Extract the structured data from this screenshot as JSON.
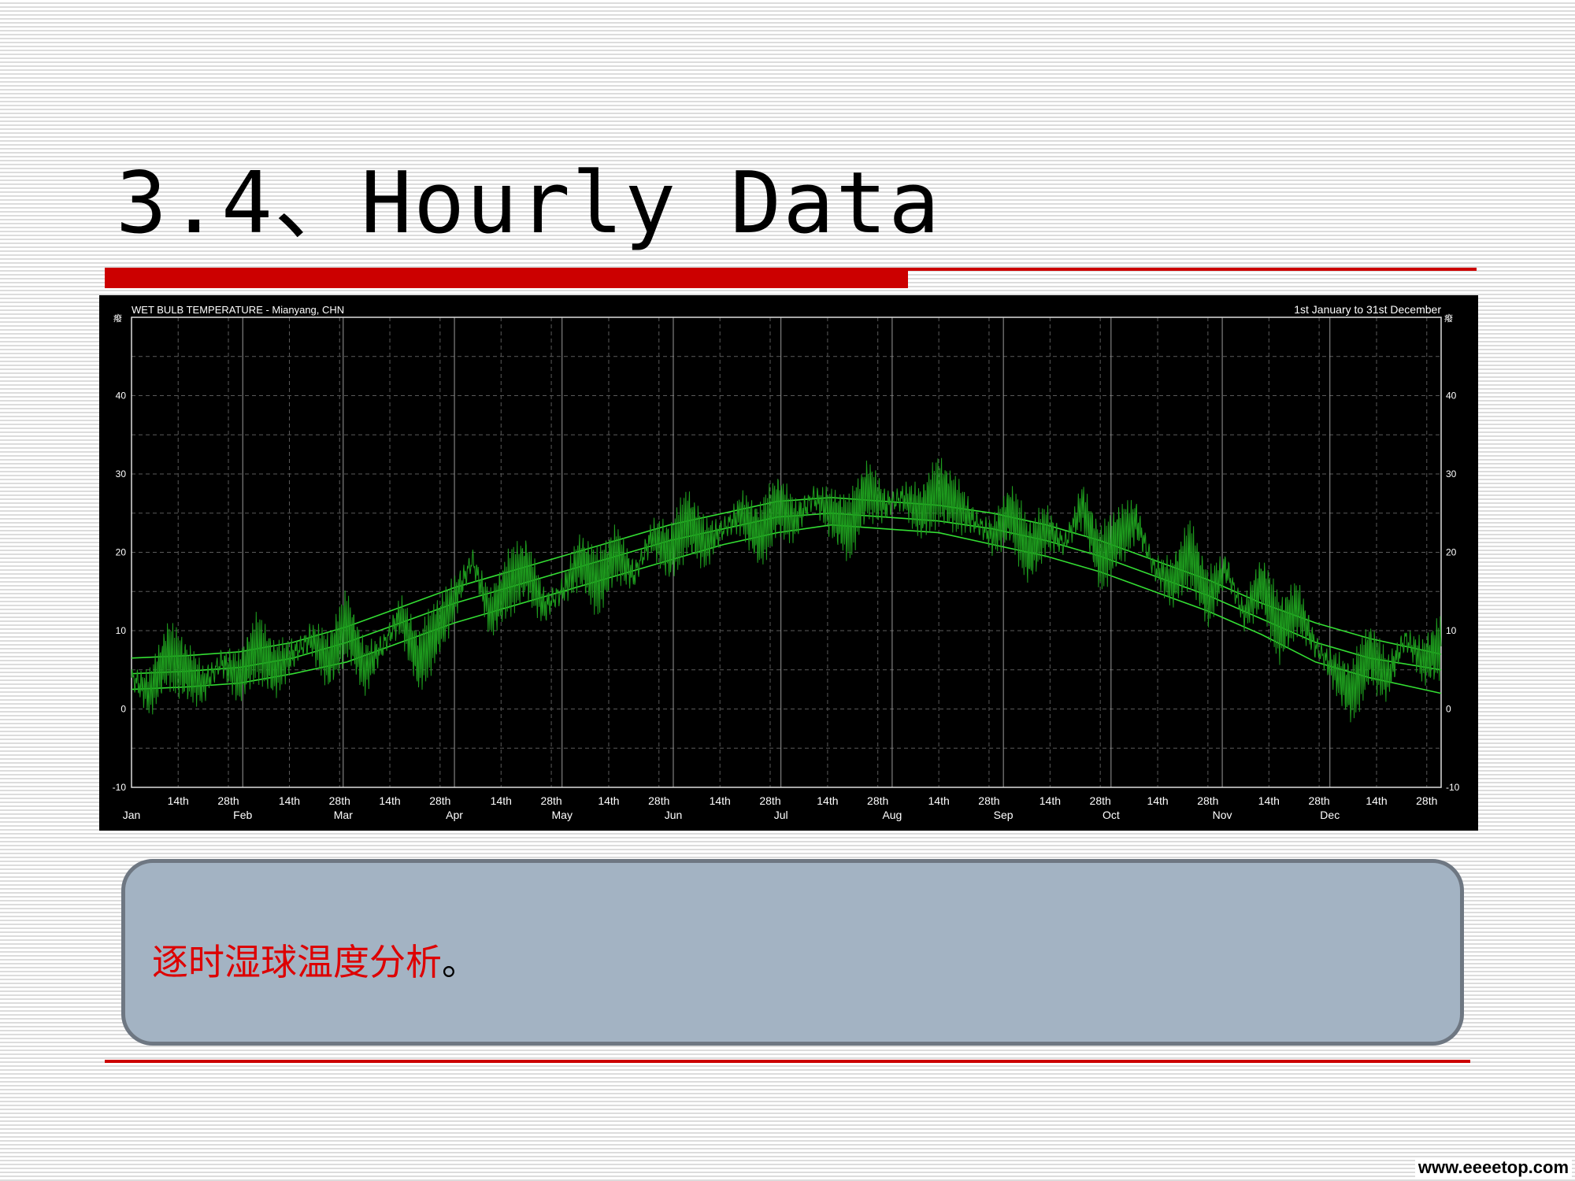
{
  "slide": {
    "title": "3.4、Hourly Data",
    "note_main": "逐时湿球温度分析",
    "note_punct": "。",
    "watermark": "www.eeeetop.com"
  },
  "colors": {
    "accent_red": "#cc0000",
    "chart_bg": "#000000",
    "raw_series": "#1e9e1e",
    "band_series": "#33dd33",
    "grid": "#5a5a5a",
    "note_bg": "#a3b3c3"
  },
  "chart_data": {
    "type": "line",
    "title": "WET BULB TEMPERATURE - Mianyang, CHN",
    "subtitle": "1st January to 31st December",
    "ylabel_left": "癈",
    "ylabel_right": "癈",
    "ylim": [
      -10,
      50
    ],
    "yticks": [
      -10,
      0,
      10,
      20,
      30,
      40
    ],
    "xlim": [
      0,
      365
    ],
    "x_axis": {
      "months": [
        "Jan",
        "Feb",
        "Mar",
        "Apr",
        "May",
        "Jun",
        "Jul",
        "Aug",
        "Sep",
        "Oct",
        "Nov",
        "Dec"
      ],
      "month_start_day": [
        0,
        31,
        59,
        90,
        120,
        151,
        181,
        212,
        243,
        273,
        304,
        334
      ],
      "minor_labels": [
        "14th",
        "28th"
      ]
    },
    "grid": true,
    "series": [
      {
        "kind": "band-upper",
        "x": [
          0,
          15,
          30,
          45,
          60,
          75,
          90,
          105,
          120,
          135,
          150,
          165,
          180,
          195,
          210,
          225,
          240,
          255,
          270,
          285,
          300,
          315,
          330,
          345,
          365
        ],
        "values": [
          6.5,
          6.8,
          7.3,
          8.5,
          10.5,
          13,
          15.5,
          17.5,
          19.5,
          21.5,
          23.5,
          25,
          26.5,
          27,
          26.5,
          26,
          25,
          23.5,
          21.5,
          19,
          16.5,
          13.5,
          11,
          9,
          7
        ]
      },
      {
        "kind": "band-mean",
        "x": [
          0,
          15,
          30,
          45,
          60,
          75,
          90,
          105,
          120,
          135,
          150,
          165,
          180,
          195,
          210,
          225,
          240,
          255,
          270,
          285,
          300,
          315,
          330,
          345,
          365
        ],
        "values": [
          4.5,
          4.8,
          5.3,
          6.5,
          8.5,
          11,
          13.5,
          15.5,
          17.5,
          19.5,
          21.5,
          23,
          24.5,
          25,
          24.5,
          24,
          23,
          21.5,
          19.5,
          17,
          14.5,
          11.5,
          8.5,
          6.5,
          5
        ]
      },
      {
        "kind": "band-lower",
        "x": [
          0,
          15,
          30,
          45,
          60,
          75,
          90,
          105,
          120,
          135,
          150,
          165,
          180,
          195,
          210,
          225,
          240,
          255,
          270,
          285,
          300,
          315,
          330,
          345,
          365
        ],
        "values": [
          2.5,
          2.8,
          3.3,
          4.5,
          6,
          8.5,
          11,
          13,
          15,
          17,
          19,
          21,
          22.5,
          23.5,
          23,
          22.5,
          21,
          19.5,
          17.5,
          15,
          12.5,
          9.5,
          6,
          4,
          2
        ]
      },
      {
        "kind": "hourly-raw",
        "x": [
          0,
          5,
          10,
          15,
          20,
          25,
          30,
          35,
          40,
          45,
          50,
          55,
          60,
          65,
          70,
          75,
          80,
          85,
          90,
          95,
          100,
          105,
          110,
          115,
          120,
          125,
          130,
          135,
          140,
          145,
          150,
          155,
          160,
          165,
          170,
          175,
          180,
          185,
          190,
          195,
          200,
          205,
          210,
          215,
          220,
          225,
          230,
          235,
          240,
          245,
          250,
          255,
          260,
          265,
          270,
          275,
          280,
          285,
          290,
          295,
          300,
          305,
          310,
          315,
          320,
          325,
          330,
          335,
          340,
          345,
          350,
          355,
          360,
          365
        ],
        "values": [
          4,
          2,
          7,
          5,
          3,
          6,
          4,
          8,
          5,
          7,
          9,
          6,
          11,
          5,
          8,
          12,
          6,
          10,
          14,
          19,
          12,
          16,
          18,
          13,
          15,
          19,
          16,
          20,
          17,
          22,
          20,
          24,
          21,
          23,
          25,
          22,
          26,
          24,
          27,
          25,
          23,
          28,
          26,
          27,
          25,
          28,
          26,
          24,
          22,
          25,
          20,
          23,
          21,
          26,
          19,
          22,
          24,
          18,
          16,
          20,
          14,
          18,
          12,
          16,
          10,
          13,
          8,
          5,
          2,
          7,
          4,
          9,
          6,
          8
        ]
      }
    ]
  }
}
